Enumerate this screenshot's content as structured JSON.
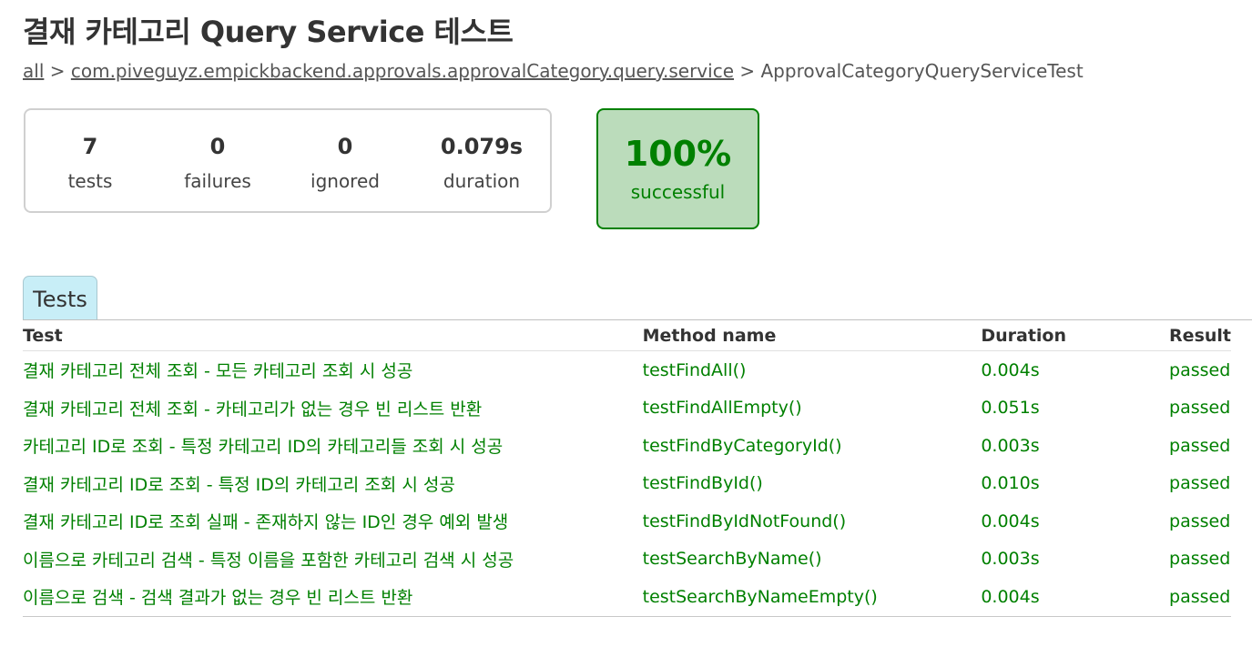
{
  "page": {
    "title": "결재 카테고리 Query Service 테스트"
  },
  "breadcrumbs": {
    "items": [
      {
        "label": "all",
        "link": true
      },
      {
        "label": "com.piveguyz.empickbackend.approvals.approvalCategory.query.service",
        "link": true
      },
      {
        "label": "ApprovalCategoryQueryServiceTest",
        "link": false
      }
    ],
    "separator": ">"
  },
  "summary": {
    "tests": {
      "value": "7",
      "label": "tests"
    },
    "failures": {
      "value": "0",
      "label": "failures"
    },
    "ignored": {
      "value": "0",
      "label": "ignored"
    },
    "duration": {
      "value": "0.079s",
      "label": "duration"
    },
    "success": {
      "value": "100%",
      "label": "successful"
    }
  },
  "tabs": [
    {
      "label": "Tests",
      "active": true
    }
  ],
  "table": {
    "headers": [
      "Test",
      "Method name",
      "Duration",
      "Result"
    ],
    "rows": [
      {
        "test": "결재 카테고리 전체 조회 - 모든 카테고리 조회 시 성공",
        "method": "testFindAll()",
        "duration": "0.004s",
        "result": "passed"
      },
      {
        "test": "결재 카테고리 전체 조회 - 카테고리가 없는 경우 빈 리스트 반환",
        "method": "testFindAllEmpty()",
        "duration": "0.051s",
        "result": "passed"
      },
      {
        "test": "카테고리 ID로 조회 - 특정 카테고리 ID의 카테고리들 조회 시 성공",
        "method": "testFindByCategoryId()",
        "duration": "0.003s",
        "result": "passed"
      },
      {
        "test": "결재 카테고리 ID로 조회 - 특정 ID의 카테고리 조회 시 성공",
        "method": "testFindById()",
        "duration": "0.010s",
        "result": "passed"
      },
      {
        "test": "결재 카테고리 ID로 조회 실패 - 존재하지 않는 ID인 경우 예외 발생",
        "method": "testFindByIdNotFound()",
        "duration": "0.004s",
        "result": "passed"
      },
      {
        "test": "이름으로 카테고리 검색 - 특정 이름을 포함한 카테고리 검색 시 성공",
        "method": "testSearchByName()",
        "duration": "0.003s",
        "result": "passed"
      },
      {
        "test": "이름으로 검색 - 검색 결과가 없는 경우 빈 리스트 반환",
        "method": "testSearchByNameEmpty()",
        "duration": "0.004s",
        "result": "passed"
      }
    ]
  },
  "colors": {
    "success": "#008000",
    "success_bg": "#bbdcbb",
    "tab_bg": "#c8eef7"
  }
}
